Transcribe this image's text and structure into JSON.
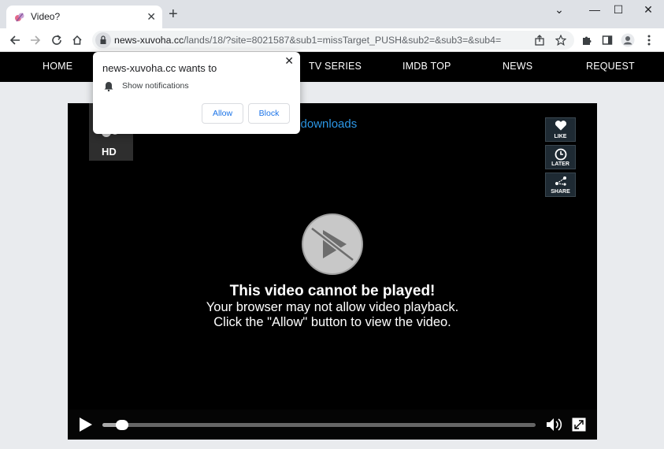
{
  "browser": {
    "tab": {
      "title": "Video?"
    },
    "url": {
      "domain": "news-xuvoha.cc",
      "path": "/lands/18/?site=8021587&sub1=missTarget_PUSH&sub2=&sub3=&sub4="
    }
  },
  "site_nav": [
    "HOME",
    "TV SERIES",
    "IMDB TOP",
    "NEWS",
    "REQUEST"
  ],
  "player": {
    "hd_label": "HD",
    "title": "d downloads",
    "side_buttons": [
      "LIKE",
      "LATER",
      "SHARE"
    ],
    "message": {
      "title": "This video cannot be played!",
      "line1": "Your browser may not allow video playback.",
      "line2": "Click the \"Allow\" button to view the video."
    },
    "progress": 0.03
  },
  "prompt": {
    "title": "news-xuvoha.cc wants to",
    "description": "Show notifications",
    "allow": "Allow",
    "block": "Block"
  },
  "colors": {
    "link_blue": "#2c97e6",
    "prompt_button_text": "#1a73e8"
  }
}
